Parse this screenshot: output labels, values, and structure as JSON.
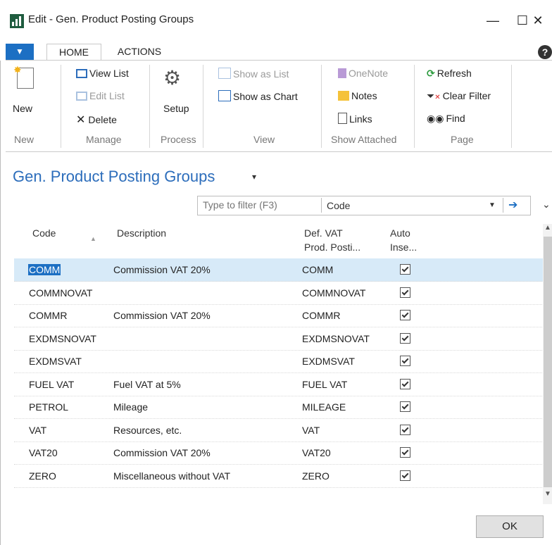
{
  "window": {
    "title": "Edit - Gen. Product Posting Groups",
    "minimize": "—",
    "maximize": "☐",
    "close": "✕"
  },
  "ribbon": {
    "file_button": "▼",
    "tabs": [
      {
        "label": "HOME",
        "active": true
      },
      {
        "label": "ACTIONS",
        "active": false
      }
    ],
    "help": "?",
    "groups": [
      {
        "label": "New",
        "items": [
          {
            "label": "New",
            "icon": "new-document-icon",
            "enabled": true
          }
        ]
      },
      {
        "label": "Manage",
        "items": [
          {
            "label": "View List",
            "icon": "view-list-icon",
            "enabled": true
          },
          {
            "label": "Edit List",
            "icon": "edit-list-icon",
            "enabled": false
          },
          {
            "label": "Delete",
            "icon": "delete-icon",
            "enabled": true
          }
        ]
      },
      {
        "label": "Process",
        "items": [
          {
            "label": "Setup",
            "icon": "gears-icon",
            "enabled": true
          }
        ]
      },
      {
        "label": "View",
        "items": [
          {
            "label": "Show as List",
            "icon": "show-as-list-icon",
            "enabled": false
          },
          {
            "label": "Show as Chart",
            "icon": "show-as-chart-icon",
            "enabled": true
          }
        ]
      },
      {
        "label": "Show Attached",
        "items": [
          {
            "label": "OneNote",
            "icon": "onenote-icon",
            "enabled": false
          },
          {
            "label": "Notes",
            "icon": "notes-icon",
            "enabled": true
          },
          {
            "label": "Links",
            "icon": "links-icon",
            "enabled": true
          }
        ]
      },
      {
        "label": "Page",
        "items": [
          {
            "label": "Refresh",
            "icon": "refresh-icon",
            "enabled": true
          },
          {
            "label": "Clear Filter",
            "icon": "clear-filter-icon",
            "enabled": true
          },
          {
            "label": "Find",
            "icon": "find-binoculars-icon",
            "enabled": true
          }
        ]
      }
    ]
  },
  "page": {
    "title": "Gen. Product Posting Groups",
    "title_caret": "▾"
  },
  "filter": {
    "placeholder": "Type to filter (F3)",
    "field": "Code",
    "dropdown": "▼",
    "go": "➔"
  },
  "grid": {
    "columns": [
      {
        "label": "Code",
        "sort": "▲"
      },
      {
        "label": "Description"
      },
      {
        "label": "Def. VAT\nProd. Posti..."
      },
      {
        "label": "Auto\nInse..."
      }
    ],
    "rows": [
      {
        "code": "COMM",
        "description": "Commission VAT 20%",
        "def_vat": "COMM",
        "auto_insert": true,
        "selected": true
      },
      {
        "code": "COMMNOVAT",
        "description": "",
        "def_vat": "COMMNOVAT",
        "auto_insert": true
      },
      {
        "code": "COMMR",
        "description": "Commission VAT 20%",
        "def_vat": "COMMR",
        "auto_insert": true
      },
      {
        "code": "EXDMSNOVAT",
        "description": "",
        "def_vat": "EXDMSNOVAT",
        "auto_insert": true
      },
      {
        "code": "EXDMSVAT",
        "description": "",
        "def_vat": "EXDMSVAT",
        "auto_insert": true
      },
      {
        "code": "FUEL VAT",
        "description": "Fuel VAT at 5%",
        "def_vat": "FUEL VAT",
        "auto_insert": true
      },
      {
        "code": "PETROL",
        "description": "Mileage",
        "def_vat": "MILEAGE",
        "auto_insert": true
      },
      {
        "code": "VAT",
        "description": "Resources, etc.",
        "def_vat": "VAT",
        "auto_insert": true
      },
      {
        "code": "VAT20",
        "description": "Commission VAT 20%",
        "def_vat": "VAT20",
        "auto_insert": true
      },
      {
        "code": "ZERO",
        "description": "Miscellaneous without VAT",
        "def_vat": "ZERO",
        "auto_insert": true
      }
    ]
  },
  "footer": {
    "ok": "OK"
  },
  "colors": {
    "accent": "#1c6fc3",
    "title_blue": "#2c6dbb",
    "selected_row": "#d7eaf8",
    "app_icon": "#1f5c3f"
  }
}
